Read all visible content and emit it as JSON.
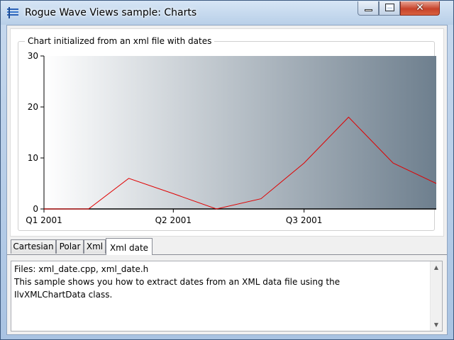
{
  "window": {
    "title": "Rogue Wave Views sample: Charts",
    "close_glyph": "✕"
  },
  "chart_data": {
    "type": "line",
    "title": "Chart initialized from an xml file with dates",
    "x_tick_labels": [
      "Q1 2001",
      "Q2 2001",
      "Q3 2001"
    ],
    "y_tick_labels": [
      "0",
      "10",
      "20",
      "30"
    ],
    "ylim": [
      0,
      30
    ],
    "x": [
      "2001-01-01",
      "2001-02-01",
      "2001-03-01",
      "2001-04-01",
      "2001-05-01",
      "2001-06-01",
      "2001-07-01",
      "2001-08-01",
      "2001-09-01",
      "2001-10-01"
    ],
    "values": [
      0,
      0,
      6,
      3,
      0,
      2,
      9,
      18,
      9,
      5
    ],
    "series_color": "#e00000",
    "grid": false,
    "background": "gradient white to slate-blue"
  },
  "tabs": [
    {
      "label": "Cartesian",
      "active": false
    },
    {
      "label": "Polar",
      "active": false
    },
    {
      "label": "Xml",
      "active": false
    },
    {
      "label": "Xml date",
      "active": true
    }
  ],
  "description": {
    "lines": [
      "Files: xml_date.cpp, xml_date.h",
      "This sample shows you how to extract dates from an XML data file using the",
      "IlvXMLChartData class."
    ],
    "scroll_up_glyph": "▲",
    "scroll_down_glyph": "▼"
  }
}
